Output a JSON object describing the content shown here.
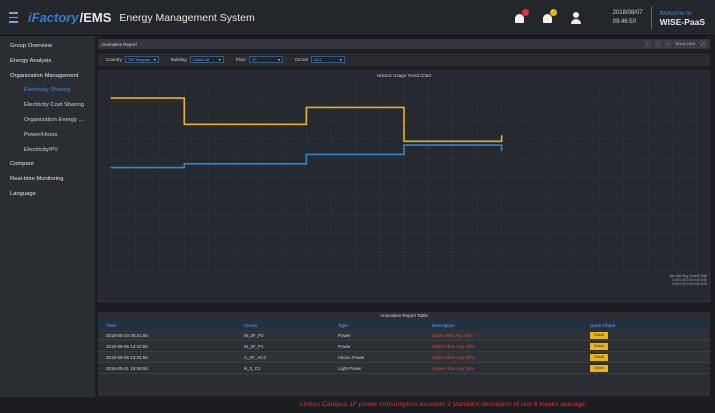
{
  "header": {
    "brand_prefix": "iFactory",
    "brand_suffix": "/EMS",
    "title": "Energy Management System",
    "date": "2018/08/07",
    "time": "09:46:50",
    "host_top": "Welcome to",
    "host_main": "WISE-PaaS",
    "notification_colors": [
      "#e03232",
      "#e8b418"
    ]
  },
  "sidebar": {
    "items": [
      {
        "label": "Group Overview",
        "level": 0,
        "active": false
      },
      {
        "label": "Energy Analysis",
        "level": 0,
        "active": false
      },
      {
        "label": "Organization Management",
        "level": 0,
        "active": false
      },
      {
        "label": "Electricity Sharing",
        "level": 1,
        "active": true
      },
      {
        "label": "Electricity Cost Sharing",
        "level": 1,
        "active": false
      },
      {
        "label": "Organization Energy ...",
        "level": 1,
        "active": false
      },
      {
        "label": "Power/Hours",
        "level": 1,
        "active": false
      },
      {
        "label": "Electricity/PV",
        "level": 1,
        "active": false
      },
      {
        "label": "Compare",
        "level": 0,
        "active": false
      },
      {
        "label": "Real-time Monitoring",
        "level": 0,
        "active": false
      },
      {
        "label": "Language",
        "level": 0,
        "active": false
      }
    ]
  },
  "panel": {
    "title": "Anomalies Report",
    "buttons": [
      "↑",
      "↓",
      "×",
      "Show Hide",
      "⤢"
    ]
  },
  "filters": {
    "country_label": "Country",
    "country_value": "TW Taoyuan",
    "building_label": "Building",
    "building_value": "Linkou AI",
    "floor_label": "Floor",
    "floor_value": "1F",
    "circuit_label": "Circuit",
    "circuit_value": "AC1"
  },
  "chart": {
    "title": "Historic Usage Trend Chart",
    "stats": [
      "Min  Max  Avg  Current  Total",
      "0.00 0.00 0.00 0.00 0.00",
      "0.00 0.00 0.00 0.00 0.00"
    ]
  },
  "chart_data": {
    "type": "line",
    "title": "Historic Usage Trend Chart",
    "ylim": [
      0,
      100
    ],
    "grid": true,
    "x_categories": 24,
    "series": [
      {
        "color": "#e8b418",
        "points": [
          [
            0,
            92
          ],
          [
            3,
            92
          ],
          [
            3,
            78
          ],
          [
            8,
            78
          ],
          [
            8,
            87
          ],
          [
            12,
            87
          ],
          [
            12,
            69
          ],
          [
            16,
            69
          ],
          [
            16,
            72
          ]
        ]
      },
      {
        "color": "#2f86d0",
        "points": [
          [
            0,
            55
          ],
          [
            3,
            55
          ],
          [
            3,
            57
          ],
          [
            8,
            57
          ],
          [
            8,
            62
          ],
          [
            12,
            62
          ],
          [
            12,
            67
          ],
          [
            16,
            67
          ],
          [
            16,
            64
          ]
        ]
      }
    ]
  },
  "table": {
    "title": "Anomalies Report Table",
    "headers": [
      "Time",
      "Circuit",
      "Type",
      "Description",
      "Quick Check"
    ],
    "rows": [
      {
        "time": "2018-05-10 08:41:55",
        "circuit": "M_3F_P2",
        "type": "Power",
        "desc": "Lower than Avg 40%",
        "action": "Check"
      },
      {
        "time": "2018-06-06 14:44:55",
        "circuit": "M_3F_P1",
        "type": "Power",
        "desc": "Higher than Avg 10%",
        "action": "Check"
      },
      {
        "time": "2018-05-05 13:34:55",
        "circuit": "A_2F_AC2",
        "type": "Aircon Power",
        "desc": "Higher than Avg 20%",
        "action": "Check"
      },
      {
        "time": "2018-05-01 18:59:55",
        "circuit": "N_3_C1",
        "type": "Light Power",
        "desc": "Higher than Avg 20%",
        "action": "Check"
      }
    ]
  },
  "status": {
    "message": "Linkou Campus 1F power consumption exceeds 2 standard deviations of last 4 weeks average."
  }
}
